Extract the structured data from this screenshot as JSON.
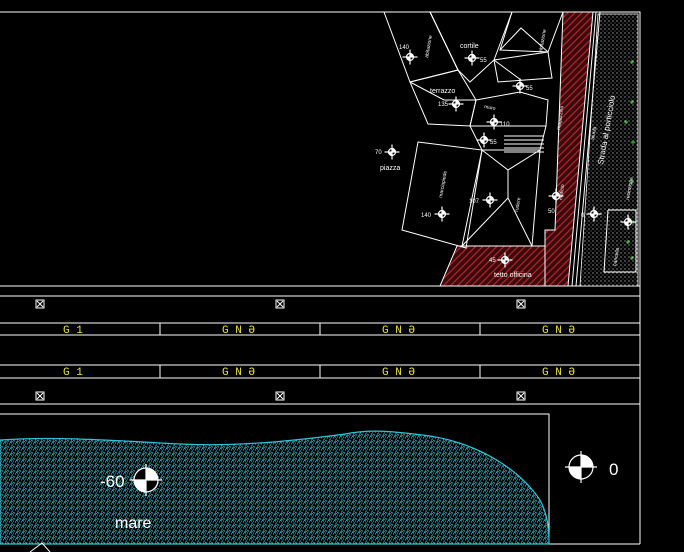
{
  "drawing": {
    "colors": {
      "background": "#000000",
      "linework": "#ffffff",
      "sea_hatch": "#2ec4d6",
      "road_hatch": "#c0272d",
      "label_yellow": "#e8e23a",
      "vegetation": "#3cc43c"
    },
    "plan_labels": {
      "cortile": "cortile",
      "terrazzo": "terrazzo",
      "piazza": "piazza",
      "tetto_officina": "tetto officina",
      "strada_porticciolo": "Strada al porticciolo",
      "small_a": "abitazione",
      "small_b": "abitazione",
      "small_c": "magazzino",
      "small_d": "edificio",
      "small_e": "rudere",
      "small_f": "marciapiede",
      "small_g": "muro",
      "small_h": "recinzione",
      "small_i": "cancello",
      "small_j": "aiuola"
    },
    "elevations": {
      "e140a": "140",
      "e55a": "55",
      "e55b": "55",
      "e135": "135",
      "e110": "110",
      "e55c": "55",
      "e70": "70",
      "e107": "107",
      "e140b": "140",
      "e50": "50",
      "e0a": "0",
      "e45": "45"
    },
    "icon_names": [
      "elevation-marker-icon",
      "bollard-marker-icon",
      "survey-benchmark-icon"
    ],
    "profile_labels": {
      "rows": [
        [
          "G 1",
          "G N Ə",
          "G N Ə",
          "G N Ə"
        ],
        [
          "G 1",
          "G N Ə",
          "G N Ə",
          "G N Ə"
        ]
      ]
    },
    "sea": {
      "level_value": "-60",
      "label": "mare"
    },
    "benchmark": {
      "value": "0"
    }
  }
}
